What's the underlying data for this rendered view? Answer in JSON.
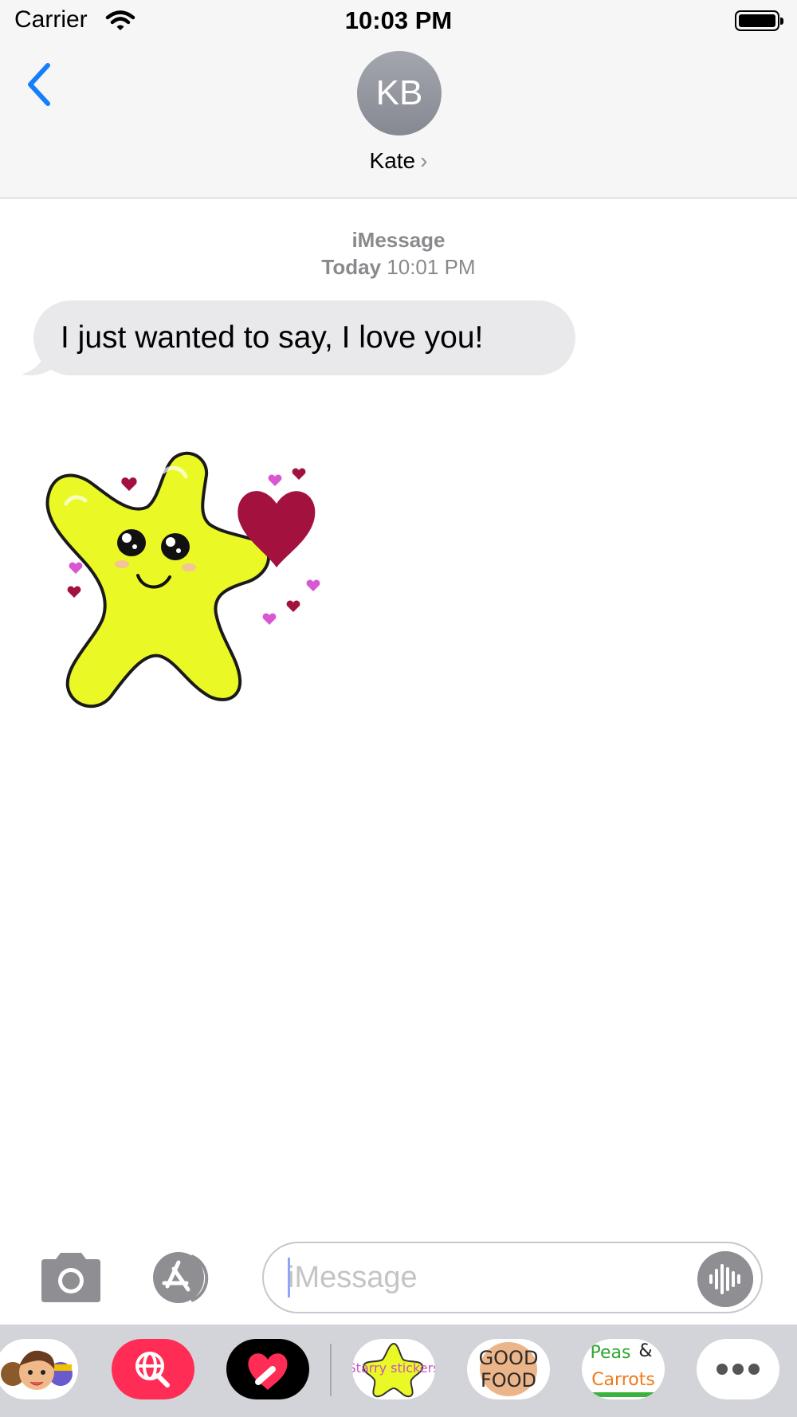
{
  "status_bar": {
    "carrier": "Carrier",
    "time": "10:03 PM"
  },
  "header": {
    "avatar_initials": "KB",
    "contact_name": "Kate"
  },
  "conversation": {
    "service": "iMessage",
    "timestamp_day": "Today",
    "timestamp_time": "10:01 PM",
    "messages": [
      {
        "text": "I just wanted to say, I love you!",
        "direction": "incoming"
      }
    ],
    "sticker": {
      "icon": "smiling-star-with-hearts-sticker"
    }
  },
  "compose": {
    "placeholder": "iMessage"
  },
  "app_drawer": {
    "items": [
      {
        "name": "memoji",
        "icon": "memoji-icon"
      },
      {
        "name": "images-search",
        "icon": "globe-search-icon"
      },
      {
        "name": "digital-touch",
        "icon": "heart-touch-icon"
      },
      {
        "name": "starry-stickers",
        "icon": "starry-stickers-icon",
        "label": "Starry stickers"
      },
      {
        "name": "good-food",
        "icon": "good-food-icon",
        "label_line1": "GOOD",
        "label_line2": "FOOD"
      },
      {
        "name": "peas-and-carrots",
        "icon": "peas-carrots-icon",
        "label_line1": "Peas",
        "label_amp": "&",
        "label_line2": "Carrots"
      },
      {
        "name": "more",
        "icon": "more-icon"
      }
    ]
  },
  "colors": {
    "accent": "#147efb",
    "bubble_gray": "#e9e9eb",
    "star_yellow": "#eaf825",
    "heart_maroon": "#a3123f",
    "heart_pink": "#d957d3",
    "search_red": "#ff2d55"
  }
}
